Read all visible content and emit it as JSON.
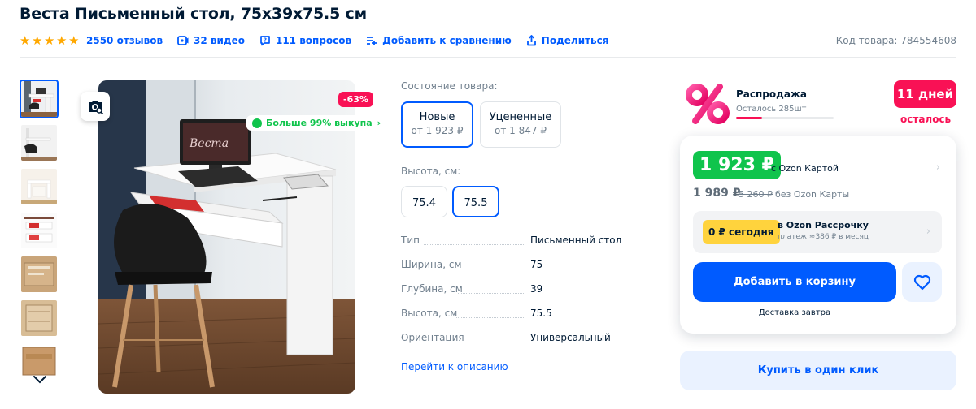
{
  "product": {
    "title": "Веста Письменный стол, 75x39x75.5 см",
    "sku_label": "Код товара: 784554608"
  },
  "meta": {
    "rating_stars": 5,
    "reviews": "2550 отзывов",
    "videos": "32 видео",
    "questions": "111 вопросов",
    "compare": "Добавить к сравнению",
    "share": "Поделиться"
  },
  "gallery": {
    "thumb_icons": [
      "desk-front",
      "desk-side",
      "desk-drawer",
      "desk-detail",
      "box-open",
      "box-parts",
      "box-packed"
    ],
    "discount_badge": "-63%",
    "buyout_badge": "Больше 99% выкупа",
    "monitor_text": "Веста"
  },
  "condition": {
    "label": "Состояние товара:",
    "options": [
      {
        "name": "Новые",
        "price": "от 1 923 ₽",
        "selected": true
      },
      {
        "name": "Уцененные",
        "price": "от 1 847 ₽",
        "selected": false
      }
    ]
  },
  "height": {
    "label": "Высота, см:",
    "options": [
      {
        "value": "75.4",
        "selected": false
      },
      {
        "value": "75.5",
        "selected": true
      }
    ]
  },
  "specs": [
    {
      "key": "Тип",
      "value": "Письменный стол"
    },
    {
      "key": "Ширина, см",
      "value": "75"
    },
    {
      "key": "Глубина, см",
      "value": "39"
    },
    {
      "key": "Высота, см",
      "value": "75.5"
    },
    {
      "key": "Ориентация",
      "value": "Универсальный"
    }
  ],
  "description_link": "Перейти к описанию",
  "sale": {
    "title": "Распродажа",
    "remaining": "Осталось 285шт",
    "remaining_fraction": 0.27,
    "days": "11 дней",
    "days_sub": "осталось"
  },
  "price": {
    "card_price": "1 923 ₽",
    "card_label": "с Ozon Картой",
    "regular_price": "1 989 ₽",
    "old_price": "5 260 ₽",
    "regular_label": "без Ozon Карты"
  },
  "installment": {
    "today": "0 ₽ сегодня",
    "title": "в Ozon Рассрочку",
    "subtitle": "платеж ≈386 ₽ в месяц"
  },
  "actions": {
    "add_to_cart": "Добавить в корзину",
    "delivery": "Доставка завтра",
    "buy_one_click": "Купить в один клик"
  },
  "colors": {
    "accent": "#005bff",
    "sale": "#f91155",
    "green": "#10c44c",
    "yellow": "#ffd33d"
  }
}
